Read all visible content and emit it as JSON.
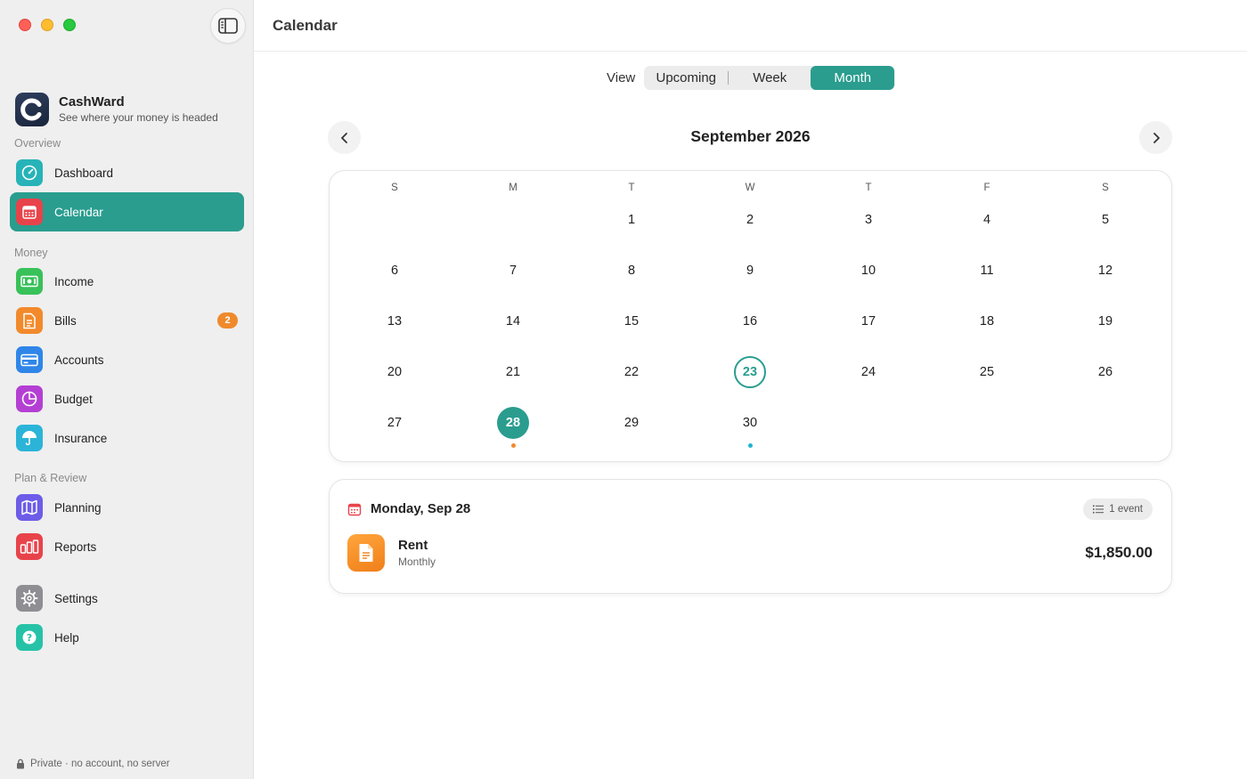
{
  "app": {
    "name": "CashWard",
    "tagline": "See where your money is headed",
    "privacy_note": "Private · no account, no server"
  },
  "sidebar": {
    "sections": {
      "overview": "Overview",
      "money": "Money",
      "plan": "Plan & Review"
    },
    "items": [
      {
        "label": "Dashboard",
        "icon": "gauge-icon",
        "color": "#27b3b8"
      },
      {
        "label": "Calendar",
        "icon": "calendar-icon",
        "color": "#e8434a",
        "active": true
      },
      {
        "label": "Income",
        "icon": "banknote-icon",
        "color": "#39c15a"
      },
      {
        "label": "Bills",
        "icon": "document-icon",
        "color": "#f28a2c",
        "badge": "2"
      },
      {
        "label": "Accounts",
        "icon": "credit-card-icon",
        "color": "#2f86e8"
      },
      {
        "label": "Budget",
        "icon": "pie-chart-icon",
        "color": "#b43fd3"
      },
      {
        "label": "Insurance",
        "icon": "umbrella-icon",
        "color": "#2bb4d8"
      },
      {
        "label": "Planning",
        "icon": "map-icon",
        "color": "#6d5ce8"
      },
      {
        "label": "Reports",
        "icon": "bar-chart-icon",
        "color": "#e8434a"
      },
      {
        "label": "Settings",
        "icon": "gear-icon",
        "color": "#8e8e93"
      },
      {
        "label": "Help",
        "icon": "question-icon",
        "color": "#26c2a8"
      }
    ]
  },
  "header": {
    "title": "Calendar"
  },
  "view": {
    "label": "View",
    "options": [
      "Upcoming",
      "Week",
      "Month"
    ],
    "selected": "Month"
  },
  "calendar": {
    "month_title": "September 2026",
    "weekdays": [
      "S",
      "M",
      "T",
      "W",
      "T",
      "F",
      "S"
    ],
    "first_weekday_index": 2,
    "days_in_month": 30,
    "today": 23,
    "selected": 28,
    "event_dots": [
      {
        "day": 28,
        "color": "#f28a2c"
      },
      {
        "day": 30,
        "color": "#22b5d1"
      }
    ]
  },
  "day_detail": {
    "date_label": "Monday, Sep 28",
    "count_label": "1 event",
    "events": [
      {
        "name": "Rent",
        "frequency": "Monthly",
        "amount": "$1,850.00",
        "icon": "document-icon"
      }
    ]
  },
  "colors": {
    "accent": "#2a9d8f",
    "bill_orange": "#f28a2c"
  }
}
